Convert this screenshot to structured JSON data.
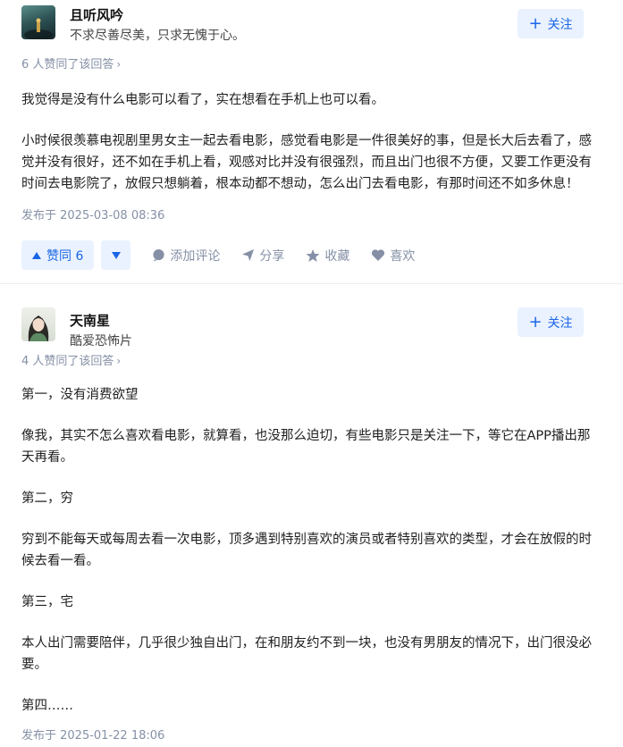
{
  "answers": [
    {
      "author": "且听风吟",
      "bio": "不求尽善尽美，只求无愧于心。",
      "follow_label": "关注",
      "votes_text": "6 人赞同了该回答",
      "paragraphs": [
        "我觉得是没有什么电影可以看了，实在想看在手机上也可以看。",
        "小时候很羡慕电视剧里男女主一起去看电影，感觉看电影是一件很美好的事，但是长大后去看了，感觉并没有很好，还不如在手机上看，观感对比并没有很强烈，而且出门也很不方便，又要工作更没有时间去电影院了，放假只想躺着，根本动都不想动，怎么出门去看电影，有那时间还不如多休息！"
      ],
      "time": "发布于 2025-03-08 08:36",
      "actions": {
        "agree": "赞同 6",
        "comment": "添加评论",
        "share": "分享",
        "collect": "收藏",
        "like": "喜欢"
      }
    },
    {
      "author": "天南星",
      "bio": "酷爱恐怖片",
      "follow_label": "关注",
      "votes_text": "4 人赞同了该回答",
      "paragraphs": [
        "第一，没有消费欲望",
        "像我，其实不怎么喜欢看电影，就算看，也没那么迫切，有些电影只是关注一下，等它在APP播出那天再看。",
        "第二，穷",
        "穷到不能每天或每周去看一次电影，顶多遇到特别喜欢的演员或者特别喜欢的类型，才会在放假的时候去看一看。",
        "第三，宅",
        "本人出门需要陪伴，几乎很少独自出门，在和朋友约不到一块，也没有男朋友的情况下，出门很没必要。",
        "第四……"
      ],
      "time": "发布于 2025-01-22 18:06"
    }
  ],
  "icons": {
    "chevron": "›",
    "plus": "+"
  },
  "colors": {
    "accent": "#1a66e6",
    "accent_bg": "#eaf2ff",
    "muted": "#8590a6"
  }
}
